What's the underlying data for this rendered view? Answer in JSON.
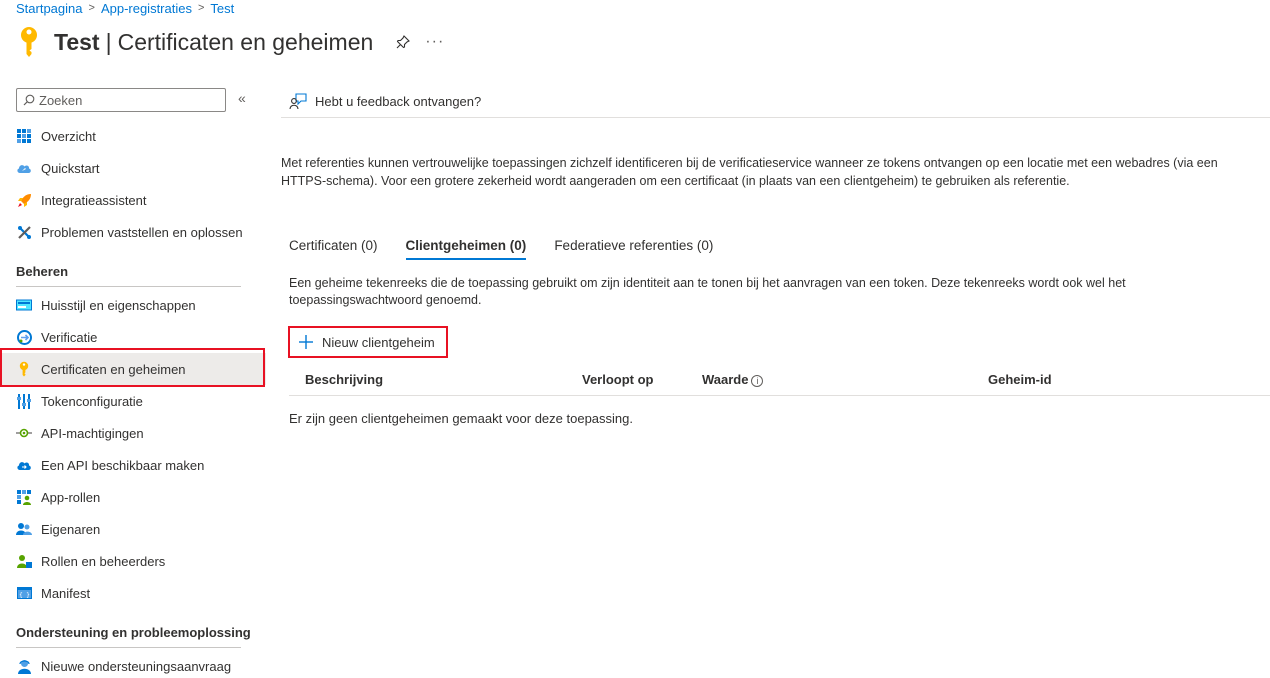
{
  "breadcrumb": [
    "Startpagina",
    "App-registraties",
    "Test"
  ],
  "header": {
    "app_name": "Test",
    "separator": "|",
    "page_title": "Certificaten en geheimen",
    "more": "···"
  },
  "sidebar": {
    "search_placeholder": "Zoeken",
    "collapse": "«",
    "group1": [
      {
        "label": "Overzicht",
        "icon": "grid-icon"
      },
      {
        "label": "Quickstart",
        "icon": "cloud-icon"
      },
      {
        "label": "Integratieassistent",
        "icon": "rocket-icon"
      },
      {
        "label": "Problemen vaststellen en oplossen",
        "icon": "wrench-icon"
      }
    ],
    "section_manage": "Beheren",
    "group2": [
      {
        "label": "Huisstijl en eigenschappen",
        "icon": "branding-icon"
      },
      {
        "label": "Verificatie",
        "icon": "authentication-icon"
      },
      {
        "label": "Certificaten en geheimen",
        "icon": "key-icon",
        "active": true
      },
      {
        "label": "Tokenconfiguratie",
        "icon": "token-bars-icon"
      },
      {
        "label": "API-machtigingen",
        "icon": "api-permissions-icon"
      },
      {
        "label": "Een API beschikbaar maken",
        "icon": "expose-api-cloud-icon"
      },
      {
        "label": "App-rollen",
        "icon": "app-roles-icon"
      },
      {
        "label": "Eigenaren",
        "icon": "owners-icon"
      },
      {
        "label": "Rollen en beheerders",
        "icon": "roles-admins-icon"
      },
      {
        "label": "Manifest",
        "icon": "manifest-icon"
      }
    ],
    "section_support": "Ondersteuning en probleemoplossing",
    "group3": [
      {
        "label": "Nieuwe ondersteuningsaanvraag",
        "icon": "support-person-icon"
      }
    ]
  },
  "main": {
    "feedback": "Hebt u feedback ontvangen?",
    "intro": "Met referenties kunnen vertrouwelijke toepassingen zichzelf identificeren bij de verificatieservice wanneer ze tokens ontvangen op een locatie met een webadres (via een HTTPS-schema). Voor een grotere zekerheid wordt aangeraden om een certificaat (in plaats van een clientgeheim) te gebruiken als referentie.",
    "tabs": [
      {
        "label": "Certificaten (0)",
        "selected": false
      },
      {
        "label": "Clientgeheimen (0)",
        "selected": true
      },
      {
        "label": "Federatieve referenties (0)",
        "selected": false
      }
    ],
    "tab_description": "Een geheime tekenreeks die de toepassing gebruikt om zijn identiteit aan te tonen bij het aanvragen van een token. Deze tekenreeks wordt ook wel het toepassingswachtwoord genoemd.",
    "new_button": "Nieuw clientgeheim",
    "columns": {
      "description": "Beschrijving",
      "expires": "Verloopt op",
      "value": "Waarde",
      "secret_id": "Geheim-id"
    },
    "empty_message": "Er zijn geen clientgeheimen gemaakt voor deze toepassing."
  },
  "colors": {
    "accent": "#0078d4",
    "highlight": "#e81123",
    "key_yellow": "#ffb900"
  }
}
